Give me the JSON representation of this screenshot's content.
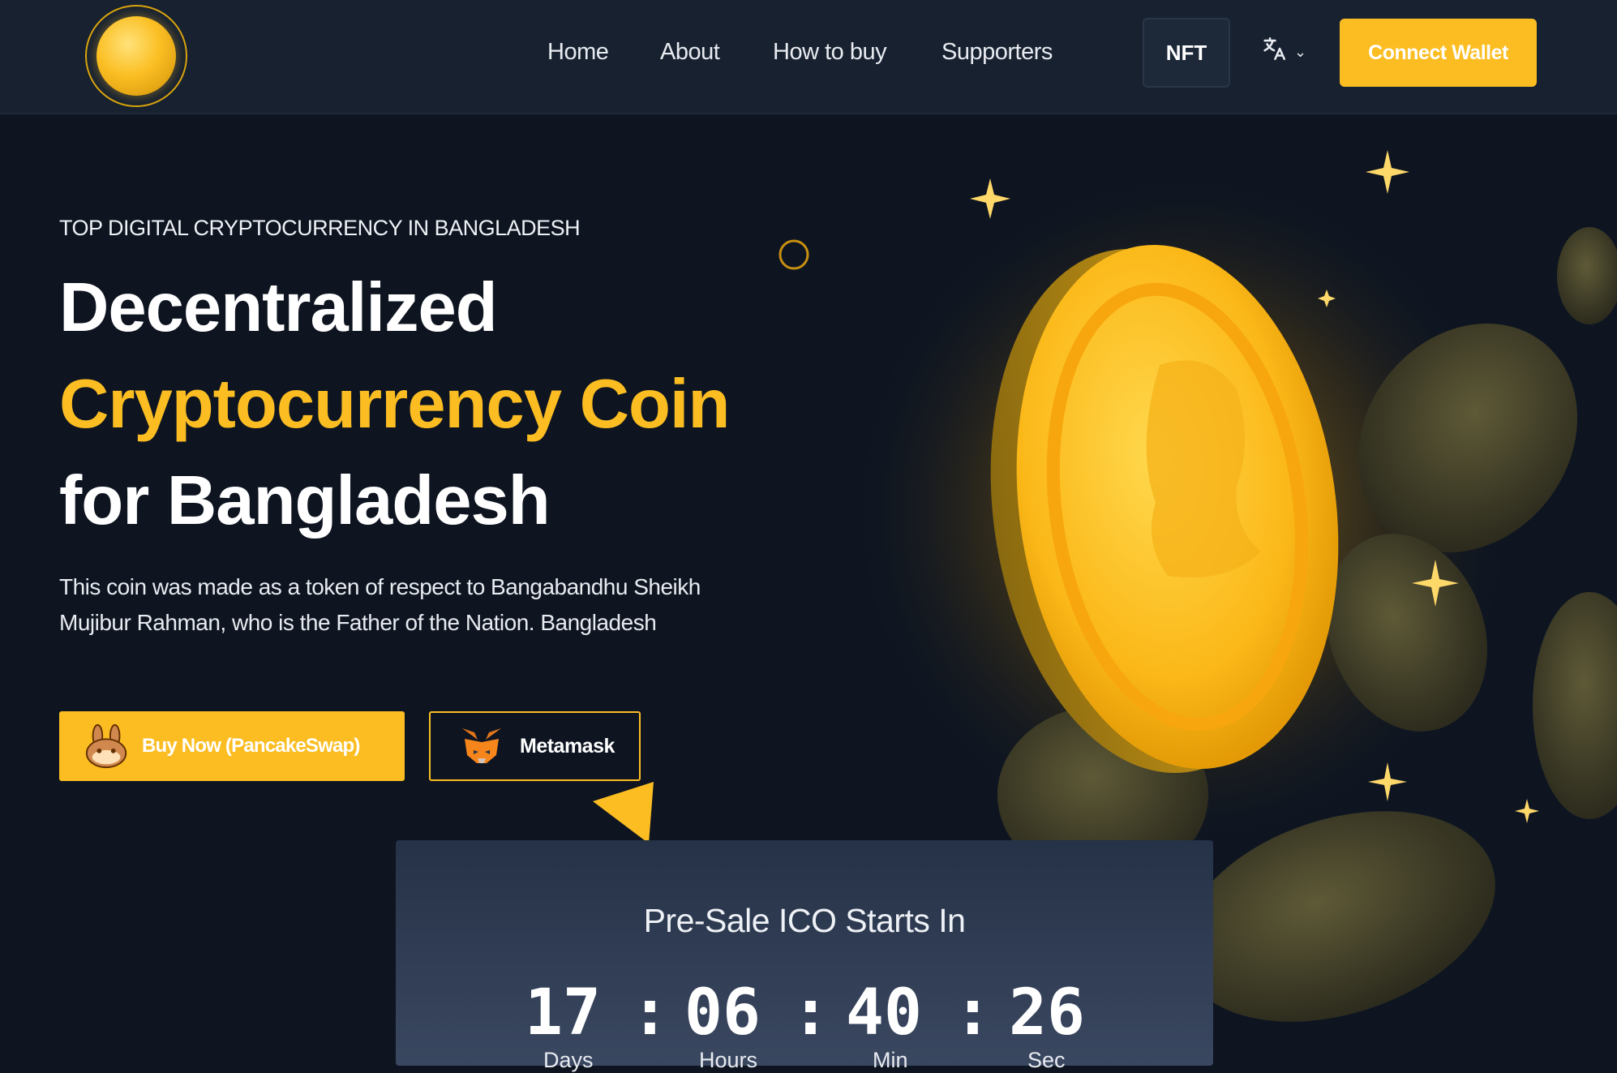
{
  "header": {
    "nav": [
      {
        "label": "Home"
      },
      {
        "label": "About"
      },
      {
        "label": "How to buy"
      },
      {
        "label": "Supporters"
      }
    ],
    "nft_label": "NFT",
    "connect_label": "Connect Wallet"
  },
  "hero": {
    "eyebrow": "TOP DIGITAL CRYPTOCURRENCY IN BANGLADESH",
    "title_line1": "Decentralized",
    "title_line2": "Cryptocurrency Coin",
    "title_line3": "for Bangladesh",
    "description": "This coin was made as a token of respect to Bangabandhu Sheikh Mujibur Rahman, who is the Father of the Nation. Bangladesh",
    "buy_label": "Buy Now (PancakeSwap)",
    "metamask_label": "Metamask"
  },
  "countdown": {
    "title": "Pre-Sale ICO Starts In",
    "days": "17",
    "hours": "06",
    "min": "40",
    "sec": "26",
    "days_label": "Days",
    "hours_label": "Hours",
    "min_label": "Min",
    "sec_label": "Sec",
    "separator": ":"
  },
  "colors": {
    "accent": "#fbbd22",
    "background": "#0e1521",
    "header": "#172130"
  },
  "icons": [
    "logo-coin-icon",
    "translate-icon",
    "chevron-down-icon",
    "pancakeswap-bunny-icon",
    "metamask-fox-icon"
  ]
}
